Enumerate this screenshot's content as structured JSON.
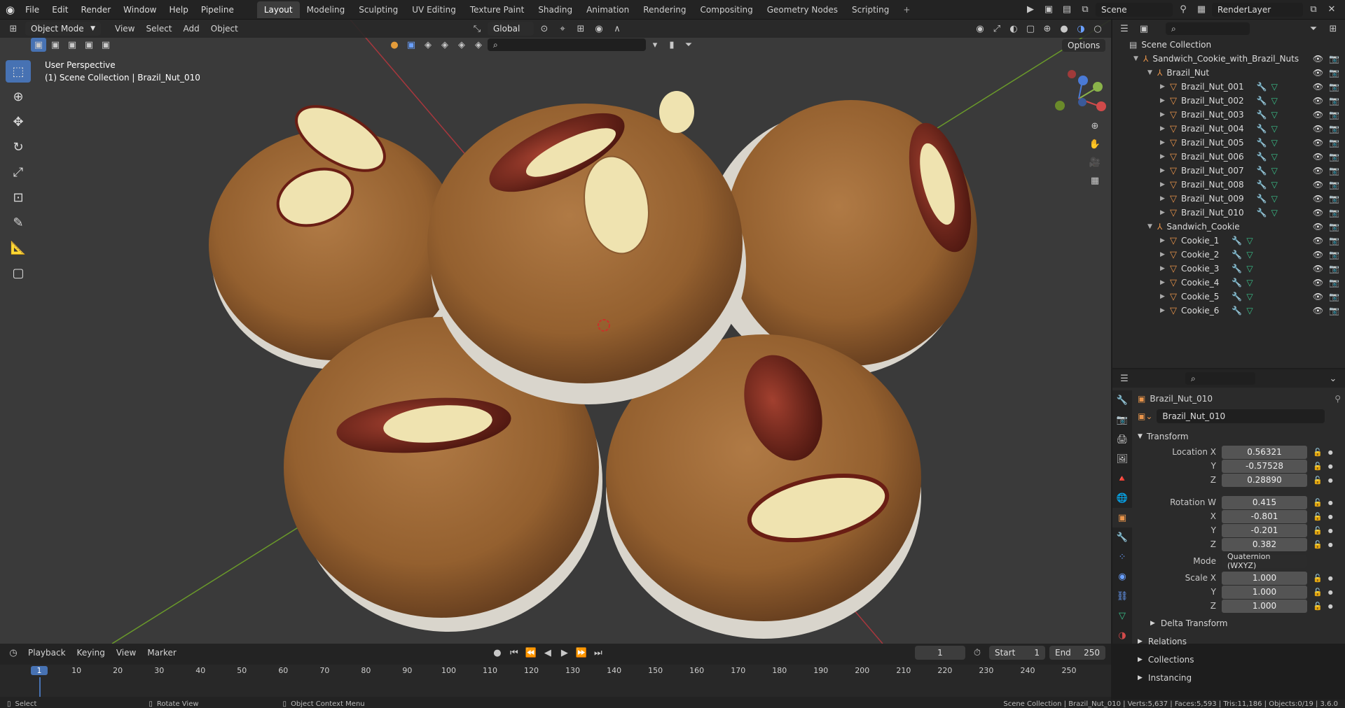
{
  "topbar": {
    "menus": [
      "File",
      "Edit",
      "Render",
      "Window",
      "Help",
      "Pipeline"
    ],
    "workspaces": [
      "Layout",
      "Modeling",
      "Sculpting",
      "UV Editing",
      "Texture Paint",
      "Shading",
      "Animation",
      "Rendering",
      "Compositing",
      "Geometry Nodes",
      "Scripting"
    ],
    "active_workspace": "Layout",
    "scene": "Scene",
    "view_layer": "RenderLayer"
  },
  "viewport": {
    "mode": "Object Mode",
    "menus": [
      "View",
      "Select",
      "Add",
      "Object"
    ],
    "transform_orientation": "Global",
    "options_label": "Options",
    "view_name": "User Perspective",
    "view_context": "(1) Scene Collection | Brazil_Nut_010"
  },
  "outliner": {
    "root": "Scene Collection",
    "collection": "Sandwich_Cookie_with_Brazil_Nuts",
    "groups": [
      {
        "name": "Brazil_Nut",
        "items": [
          "Brazil_Nut_001",
          "Brazil_Nut_002",
          "Brazil_Nut_003",
          "Brazil_Nut_004",
          "Brazil_Nut_005",
          "Brazil_Nut_006",
          "Brazil_Nut_007",
          "Brazil_Nut_008",
          "Brazil_Nut_009",
          "Brazil_Nut_010"
        ]
      },
      {
        "name": "Sandwich_Cookie",
        "items": [
          "Cookie_1",
          "Cookie_2",
          "Cookie_3",
          "Cookie_4",
          "Cookie_5",
          "Cookie_6"
        ]
      }
    ]
  },
  "properties": {
    "object_name": "Brazil_Nut_010",
    "data_name": "Brazil_Nut_010",
    "transform_label": "Transform",
    "rows": [
      {
        "label": "Location X",
        "value": "0.56321"
      },
      {
        "label": "Y",
        "value": "-0.57528"
      },
      {
        "label": "Z",
        "value": "0.28890"
      },
      {
        "label": "Rotation W",
        "value": "0.415"
      },
      {
        "label": "X",
        "value": "-0.801"
      },
      {
        "label": "Y",
        "value": "-0.201"
      },
      {
        "label": "Z",
        "value": "0.382"
      }
    ],
    "mode_label": "Mode",
    "mode_value": "Quaternion (WXYZ)",
    "scale_rows": [
      {
        "label": "Scale X",
        "value": "1.000"
      },
      {
        "label": "Y",
        "value": "1.000"
      },
      {
        "label": "Z",
        "value": "1.000"
      }
    ],
    "subpanels": [
      "Delta Transform",
      "Relations",
      "Collections",
      "Instancing"
    ]
  },
  "timeline": {
    "menus": [
      "Playback",
      "Keying",
      "View",
      "Marker"
    ],
    "current_frame": "1",
    "start_label": "Start",
    "start": "1",
    "end_label": "End",
    "end": "250",
    "ticks": [
      "1",
      "10",
      "20",
      "30",
      "40",
      "50",
      "60",
      "70",
      "80",
      "90",
      "100",
      "110",
      "120",
      "130",
      "140",
      "150",
      "160",
      "170",
      "180",
      "190",
      "200",
      "210",
      "220",
      "230",
      "240",
      "250"
    ]
  },
  "statusbar": {
    "select": "Select",
    "rotate": "Rotate View",
    "context": "Object Context Menu",
    "stats": "Scene Collection | Brazil_Nut_010 | Verts:5,637 | Faces:5,593 | Tris:11,186 | Objects:0/19 | 3.6.0"
  }
}
